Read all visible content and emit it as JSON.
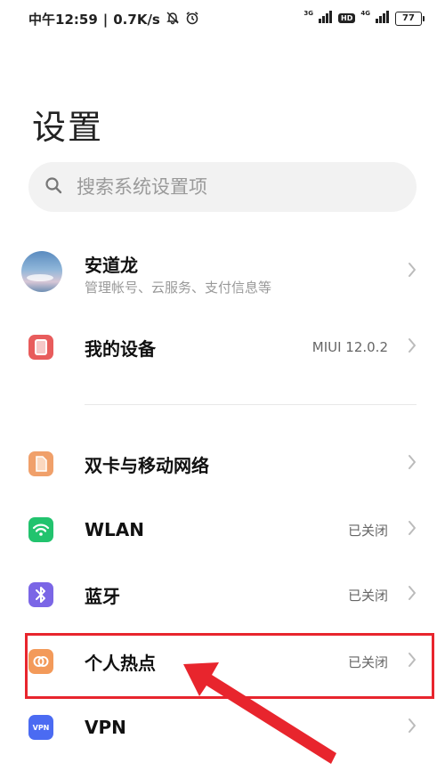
{
  "status_bar": {
    "carrier": "中午",
    "time": "12:59",
    "separator": "|",
    "speed": "0.7K/s",
    "sim1_type": "3G",
    "hd": "HD",
    "sim2_type": "4G",
    "battery": "77"
  },
  "page": {
    "title": "设置"
  },
  "search": {
    "placeholder": "搜索系统设置项"
  },
  "account": {
    "name": "安道龙",
    "subtitle": "管理帐号、云服务、支付信息等"
  },
  "device": {
    "label": "我的设备",
    "value": "MIUI 12.0.2"
  },
  "settings": [
    {
      "label": "双卡与移动网络",
      "value": ""
    },
    {
      "label": "WLAN",
      "value": "已关闭"
    },
    {
      "label": "蓝牙",
      "value": "已关闭"
    },
    {
      "label": "个人热点",
      "value": "已关闭"
    },
    {
      "label": "VPN",
      "value": ""
    }
  ],
  "icons": {
    "device": "red-square-icon",
    "sim": "sim-card-icon",
    "wlan": "wifi-icon",
    "bluetooth": "bluetooth-icon",
    "hotspot": "hotspot-icon",
    "vpn": "vpn-icon",
    "vpn_text": "VPN"
  },
  "colors": {
    "highlight": "#e8252d",
    "device_icon": "#e85c5c",
    "sim_icon": "#f0a06a",
    "wlan_icon": "#22c36e",
    "bluetooth_icon": "#7b66e6",
    "hotspot_icon": "#f39a5a",
    "vpn_icon": "#4b6bf2"
  }
}
